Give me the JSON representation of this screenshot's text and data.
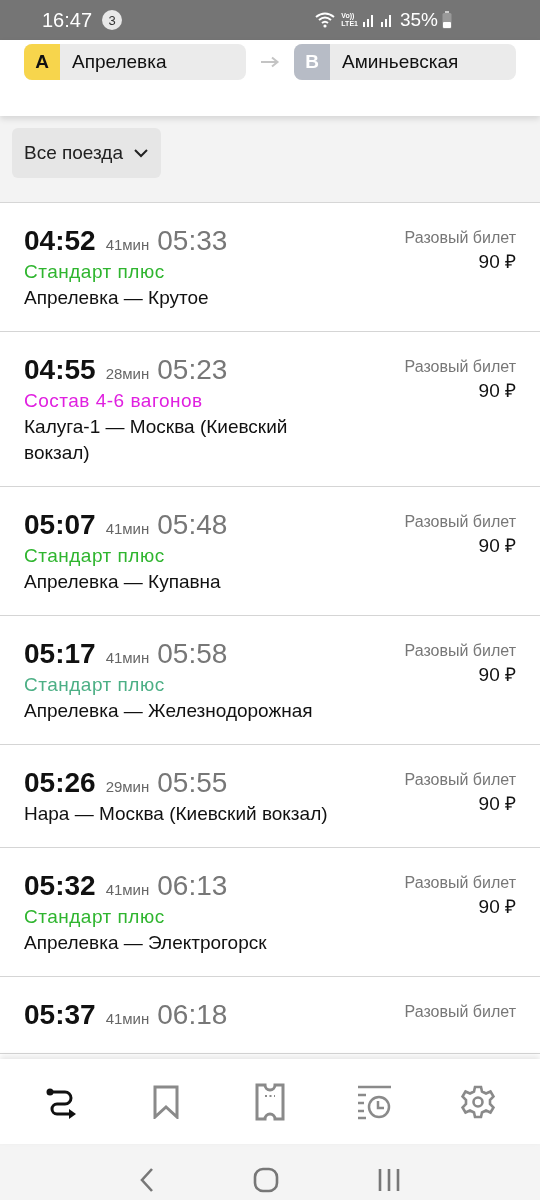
{
  "status_bar": {
    "time": "16:47",
    "notification_count": "3",
    "network": "Vo))\nLTE1",
    "battery": "35%"
  },
  "route": {
    "from": {
      "letter": "A",
      "name": "Апрелевка"
    },
    "to": {
      "letter": "B",
      "name": "Аминьевская"
    }
  },
  "filter": {
    "label": "Все поезда"
  },
  "trains": [
    {
      "departure": "04:52",
      "duration": "41мин",
      "arrival": "05:33",
      "tag": {
        "text": "Стандарт плюс",
        "color": "#2fb52f"
      },
      "route": "Апрелевка — Крутое",
      "ticket": "Разовый билет",
      "price": "90 ₽"
    },
    {
      "departure": "04:55",
      "duration": "28мин",
      "arrival": "05:23",
      "tag": {
        "text": "Состав 4-6 вагонов",
        "color": "#e020e0"
      },
      "route": "Калуга-1 — Москва (Киевский вокзал)",
      "ticket": "Разовый билет",
      "price": "90 ₽"
    },
    {
      "departure": "05:07",
      "duration": "41мин",
      "arrival": "05:48",
      "tag": {
        "text": "Стандарт плюс",
        "color": "#2fb52f"
      },
      "route": "Апрелевка — Купавна",
      "ticket": "Разовый билет",
      "price": "90 ₽"
    },
    {
      "departure": "05:17",
      "duration": "41мин",
      "arrival": "05:58",
      "tag": {
        "text": "Стандарт плюс",
        "color": "#4caf85"
      },
      "route": "Апрелевка — Железнодорожная",
      "ticket": "Разовый билет",
      "price": "90 ₽"
    },
    {
      "departure": "05:26",
      "duration": "29мин",
      "arrival": "05:55",
      "route": "Нара — Москва (Киевский вокзал)",
      "ticket": "Разовый билет",
      "price": "90 ₽"
    },
    {
      "departure": "05:32",
      "duration": "41мин",
      "arrival": "06:13",
      "tag": {
        "text": "Стандарт плюс",
        "color": "#2fb52f"
      },
      "route": "Апрелевка — Электрогорск",
      "ticket": "Разовый билет",
      "price": "90 ₽"
    },
    {
      "departure": "05:37",
      "duration": "41мин",
      "arrival": "06:18",
      "ticket": "Разовый билет"
    }
  ],
  "tab_bar": [
    {
      "kind": "routes",
      "selected": true
    },
    {
      "kind": "bookmarks",
      "selected": false
    },
    {
      "kind": "tickets",
      "selected": false
    },
    {
      "kind": "history",
      "selected": false
    },
    {
      "kind": "settings",
      "selected": false
    }
  ]
}
